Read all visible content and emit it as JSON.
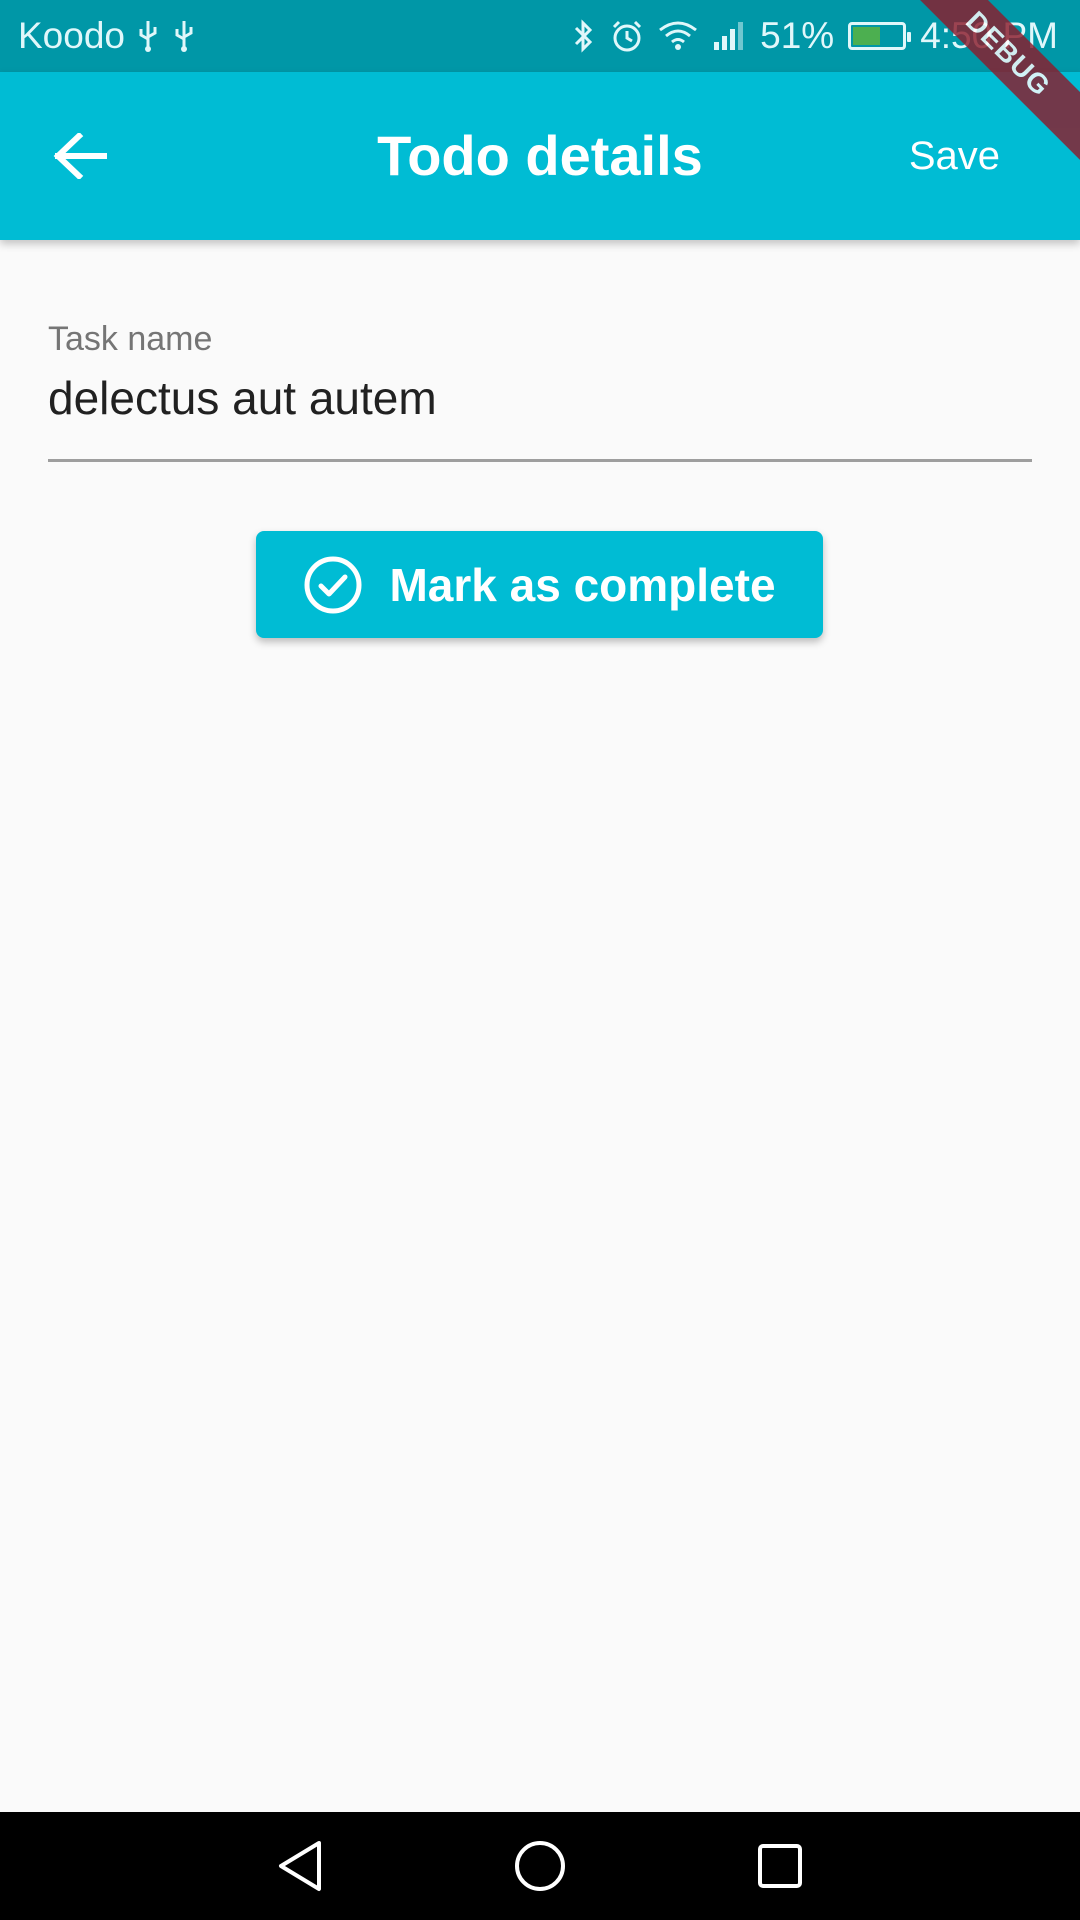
{
  "status_bar": {
    "carrier": "Koodo",
    "battery_percent": "51%",
    "battery_level": 0.51,
    "time": "4:50 PM",
    "icons": [
      "usb-icon",
      "usb-icon",
      "bluetooth-icon",
      "alarm-icon",
      "wifi-icon",
      "signal-icon",
      "battery-icon"
    ]
  },
  "app_bar": {
    "title": "Todo details",
    "save_label": "Save",
    "back_icon": "arrow-back-icon"
  },
  "debug_banner": "DEBUG",
  "form": {
    "task_label": "Task name",
    "task_value": "delectus aut autem"
  },
  "complete_button": {
    "label": "Mark as complete",
    "icon": "check-circle-icon"
  },
  "nav_bar": {
    "icons": [
      "back-triangle-icon",
      "home-circle-icon",
      "recents-square-icon"
    ]
  },
  "colors": {
    "primary": "#00bcd4",
    "primary_dark": "#0097a7",
    "background": "#fafafa",
    "debug": "#8c1c2c"
  }
}
